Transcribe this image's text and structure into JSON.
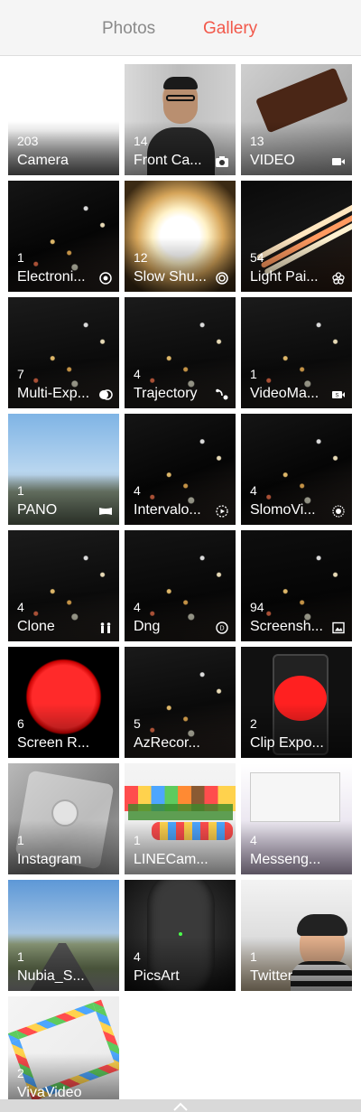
{
  "tabs": {
    "photos": "Photos",
    "gallery": "Gallery",
    "active": "gallery",
    "active_color": "#f2584a",
    "inactive_color": "#8a8a8a"
  },
  "albums": [
    {
      "count": "203",
      "label": "Camera",
      "icon": ""
    },
    {
      "count": "14",
      "label": "Front Ca...",
      "icon": "camera-icon"
    },
    {
      "count": "13",
      "label": "VIDEO",
      "icon": "video-icon"
    },
    {
      "count": "1",
      "label": "Electroni...",
      "icon": "aperture-icon"
    },
    {
      "count": "12",
      "label": "Slow Shu...",
      "icon": "shutter-icon"
    },
    {
      "count": "54",
      "label": "Light Pai...",
      "icon": "flower-icon"
    },
    {
      "count": "7",
      "label": "Multi-Exp...",
      "icon": "multi-exposure-icon"
    },
    {
      "count": "4",
      "label": "Trajectory",
      "icon": "trajectory-icon"
    },
    {
      "count": "1",
      "label": "VideoMa...",
      "icon": "video-maker-icon"
    },
    {
      "count": "1",
      "label": "PANO",
      "icon": "panorama-icon"
    },
    {
      "count": "4",
      "label": "Intervalo...",
      "icon": "interval-icon"
    },
    {
      "count": "4",
      "label": "SlomoVi...",
      "icon": "slomo-icon"
    },
    {
      "count": "4",
      "label": "Clone",
      "icon": "clone-icon"
    },
    {
      "count": "4",
      "label": "Dng",
      "icon": "dng-icon"
    },
    {
      "count": "94",
      "label": "Screensh...",
      "icon": "screenshot-icon"
    },
    {
      "count": "6",
      "label": "Screen R...",
      "icon": ""
    },
    {
      "count": "5",
      "label": "AzRecor...",
      "icon": ""
    },
    {
      "count": "2",
      "label": "Clip Expo...",
      "icon": ""
    },
    {
      "count": "1",
      "label": "Instagram",
      "icon": ""
    },
    {
      "count": "1",
      "label": "LINECam...",
      "icon": ""
    },
    {
      "count": "4",
      "label": "Messeng...",
      "icon": ""
    },
    {
      "count": "1",
      "label": "Nubia_S...",
      "icon": ""
    },
    {
      "count": "4",
      "label": "PicsArt",
      "icon": ""
    },
    {
      "count": "1",
      "label": "Twitter",
      "icon": ""
    },
    {
      "count": "2",
      "label": "VivaVideo",
      "icon": ""
    }
  ],
  "bottom_bar": {
    "icon": "chevron-up-icon"
  }
}
